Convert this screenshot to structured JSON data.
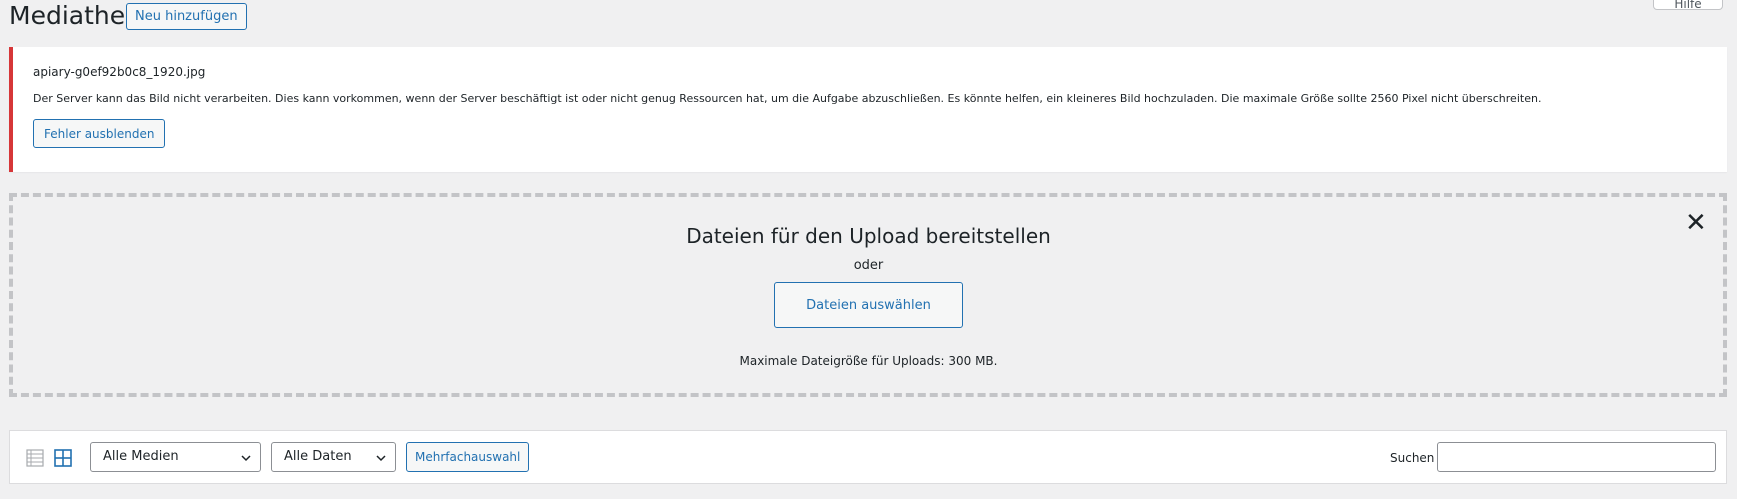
{
  "header": {
    "title": "Mediathek",
    "add_new_label": "Neu hinzufügen",
    "help_tab_label": "Hilfe"
  },
  "notice": {
    "filename": "apiary-g0ef92b0c8_1920.jpg",
    "message": "Der Server kann das Bild nicht verarbeiten. Dies kann vorkommen, wenn der Server beschäftigt ist oder nicht genug Ressourcen hat, um die Aufgabe abzuschließen. Es könnte helfen, ein kleineres Bild hochzuladen. Die maximale Größe sollte 2560 Pixel nicht überschreiten.",
    "dismiss_label": "Fehler ausblenden",
    "accent_color": "#d63638"
  },
  "uploader": {
    "title": "Dateien für den Upload bereitstellen",
    "or_text": "oder",
    "select_files_label": "Dateien auswählen",
    "max_size_text": "Maximale Dateigröße für Uploads: 300 MB.",
    "close_icon": "close-icon"
  },
  "toolbar": {
    "list_view_icon": "list-view-icon",
    "grid_view_icon": "grid-view-icon",
    "media_filter_value": "Alle Medien",
    "date_filter_value": "Alle Daten",
    "bulk_select_label": "Mehrfachauswahl",
    "search_label": "Suchen",
    "search_value": ""
  },
  "colors": {
    "primary": "#2271b1",
    "background": "#f0f0f1"
  }
}
